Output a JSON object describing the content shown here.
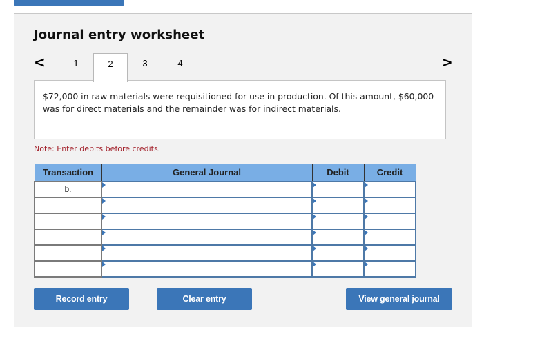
{
  "worksheet": {
    "title": "Journal entry worksheet",
    "nav": {
      "prev_icon": "chevron-left-icon",
      "next_icon": "chevron-right-icon",
      "prev_glyph": "<",
      "next_glyph": ">"
    },
    "tabs": [
      {
        "label": "1",
        "active": false
      },
      {
        "label": "2",
        "active": true
      },
      {
        "label": "3",
        "active": false
      },
      {
        "label": "4",
        "active": false
      }
    ],
    "description": "$72,000 in raw materials were requisitioned for use in production. Of this amount, $60,000 was for direct materials and the remainder was for indirect materials.",
    "note": "Note: Enter debits before credits.",
    "table": {
      "headers": [
        "Transaction",
        "General Journal",
        "Debit",
        "Credit"
      ],
      "rows": [
        {
          "transaction": "b.",
          "general_journal": "",
          "debit": "",
          "credit": ""
        },
        {
          "transaction": "",
          "general_journal": "",
          "debit": "",
          "credit": ""
        },
        {
          "transaction": "",
          "general_journal": "",
          "debit": "",
          "credit": ""
        },
        {
          "transaction": "",
          "general_journal": "",
          "debit": "",
          "credit": ""
        },
        {
          "transaction": "",
          "general_journal": "",
          "debit": "",
          "credit": ""
        },
        {
          "transaction": "",
          "general_journal": "",
          "debit": "",
          "credit": ""
        }
      ]
    },
    "buttons": {
      "record": "Record entry",
      "clear": "Clear entry",
      "view": "View general journal"
    }
  },
  "colors": {
    "accent": "#3b76b8",
    "header_bg": "#79aee5",
    "note": "#a3212b",
    "panel_bg": "#f2f2f2"
  }
}
